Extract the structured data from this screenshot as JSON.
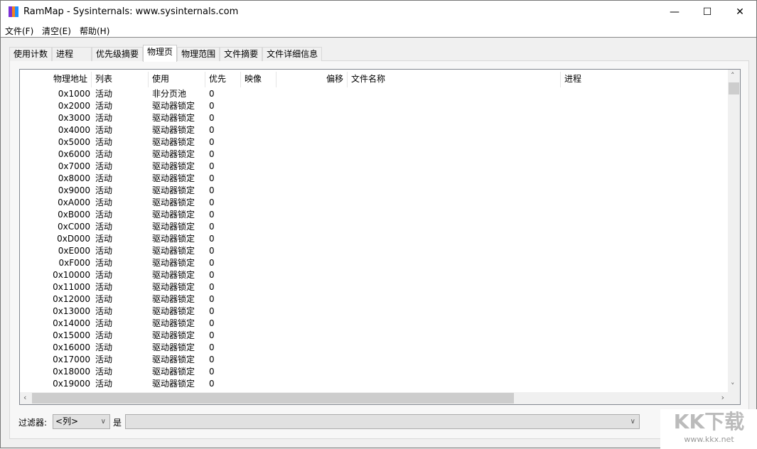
{
  "window": {
    "title": "RamMap - Sysinternals: www.sysinternals.com",
    "minimize": "—",
    "maximize": "☐",
    "close": "✕"
  },
  "menu": [
    "文件(F)",
    "清空(E)",
    "帮助(H)"
  ],
  "tabs": [
    "使用计数",
    "进程",
    "优先级摘要",
    "物理页",
    "物理范围",
    "文件摘要",
    "文件详细信息"
  ],
  "active_tab": "物理页",
  "columns": [
    "物理地址",
    "列表",
    "使用",
    "优先",
    "映像",
    "偏移",
    "文件名称",
    "进程"
  ],
  "rows": [
    [
      "0x1000",
      "活动",
      "非分页池",
      "0"
    ],
    [
      "0x2000",
      "活动",
      "驱动器锁定",
      "0"
    ],
    [
      "0x3000",
      "活动",
      "驱动器锁定",
      "0"
    ],
    [
      "0x4000",
      "活动",
      "驱动器锁定",
      "0"
    ],
    [
      "0x5000",
      "活动",
      "驱动器锁定",
      "0"
    ],
    [
      "0x6000",
      "活动",
      "驱动器锁定",
      "0"
    ],
    [
      "0x7000",
      "活动",
      "驱动器锁定",
      "0"
    ],
    [
      "0x8000",
      "活动",
      "驱动器锁定",
      "0"
    ],
    [
      "0x9000",
      "活动",
      "驱动器锁定",
      "0"
    ],
    [
      "0xA000",
      "活动",
      "驱动器锁定",
      "0"
    ],
    [
      "0xB000",
      "活动",
      "驱动器锁定",
      "0"
    ],
    [
      "0xC000",
      "活动",
      "驱动器锁定",
      "0"
    ],
    [
      "0xD000",
      "活动",
      "驱动器锁定",
      "0"
    ],
    [
      "0xE000",
      "活动",
      "驱动器锁定",
      "0"
    ],
    [
      "0xF000",
      "活动",
      "驱动器锁定",
      "0"
    ],
    [
      "0x10000",
      "活动",
      "驱动器锁定",
      "0"
    ],
    [
      "0x11000",
      "活动",
      "驱动器锁定",
      "0"
    ],
    [
      "0x12000",
      "活动",
      "驱动器锁定",
      "0"
    ],
    [
      "0x13000",
      "活动",
      "驱动器锁定",
      "0"
    ],
    [
      "0x14000",
      "活动",
      "驱动器锁定",
      "0"
    ],
    [
      "0x15000",
      "活动",
      "驱动器锁定",
      "0"
    ],
    [
      "0x16000",
      "活动",
      "驱动器锁定",
      "0"
    ],
    [
      "0x17000",
      "活动",
      "驱动器锁定",
      "0"
    ],
    [
      "0x18000",
      "活动",
      "驱动器锁定",
      "0"
    ],
    [
      "0x19000",
      "活动",
      "驱动器锁定",
      "0"
    ]
  ],
  "filter": {
    "label": "过滤器:",
    "column_value": "<列>",
    "is_label": "是",
    "value": ""
  },
  "watermark": {
    "logo": "KK下载",
    "url": "www.kkx.net"
  },
  "icon_colors": [
    "#7b2fd6",
    "#f58220",
    "#1e90ff"
  ]
}
